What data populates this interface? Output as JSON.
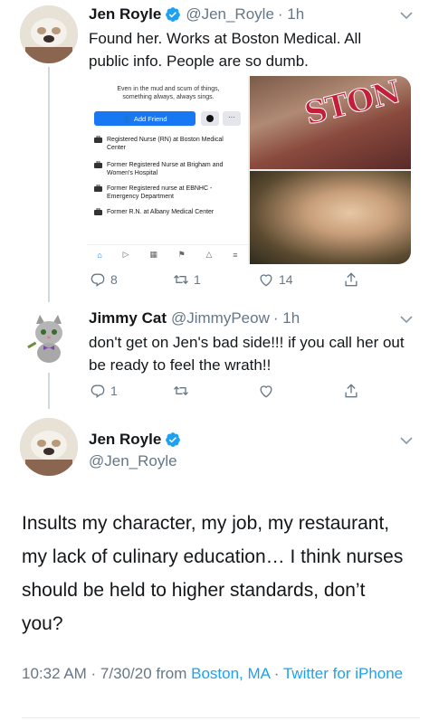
{
  "tweet1": {
    "name": "Jen Royle",
    "handle": "@Jen_Royle",
    "time": "· 1h",
    "text": "Found her. Works at Boston Medical. All public info. People are so dumb.",
    "media": {
      "motto_line1": "Even in the mud and scum of things,",
      "motto_line2": "something always, always sings.",
      "add_friend": "Add Friend",
      "more": "···",
      "jobs": [
        "Registered Nurse (RN) at Boston Medical Center",
        "Former Registered Nurse at Brigham and Women's Hospital",
        "Former Registered nurse at EBNHC - Emergency Department",
        "Former R.N. at Albany Medical Center"
      ],
      "jersey_text": "STON"
    },
    "reply_count": "8",
    "retweet_count": "1",
    "like_count": "14"
  },
  "tweet2": {
    "name": "Jimmy Cat",
    "handle": "@JimmyPeow",
    "time": "· 1h",
    "text": "don't get on Jen's bad side!!! if you call her out be ready to feel the wrath!!",
    "reply_count": "1"
  },
  "tweet3": {
    "name": "Jen Royle",
    "handle": "@Jen_Royle",
    "text": "Insults my character, my job, my restaurant, my lack of culinary education… I think nurses should be held to higher standards, don’t you?",
    "time_date": "10:32 AM · 7/30/20 from ",
    "location": "Boston, MA",
    "separator": " · ",
    "source": "Twitter for iPhone"
  },
  "colors": {
    "twitter_blue": "#1da1f2",
    "facebook_blue": "#1877f2",
    "secondary_text": "#657786",
    "divider": "#e6ecf0"
  },
  "icons": [
    "reply-icon",
    "retweet-icon",
    "like-icon",
    "share-icon",
    "verified-badge-icon",
    "chevron-down-icon"
  ]
}
